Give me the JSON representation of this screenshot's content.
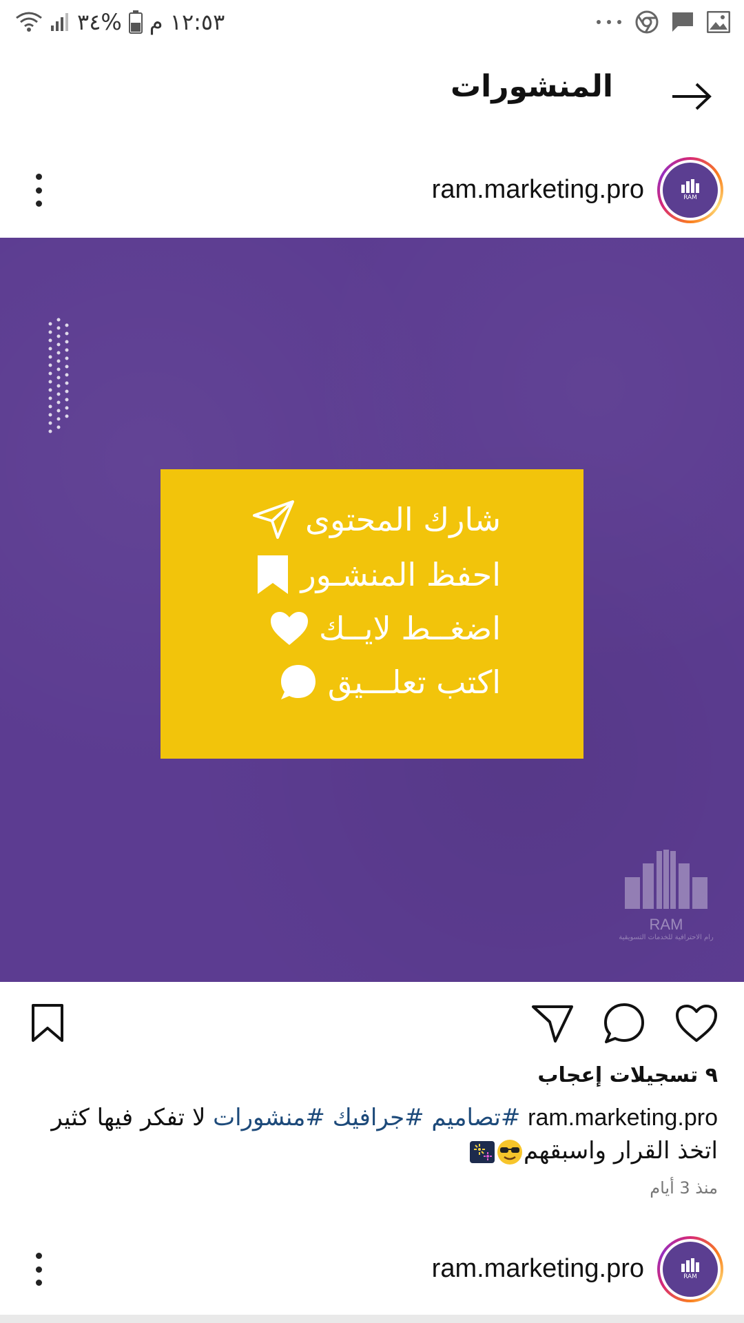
{
  "status_bar": {
    "time": "١٢:٥٣ م",
    "battery": "%٣٤"
  },
  "header": {
    "title": "المنشورات"
  },
  "post": {
    "username": "ram.marketing.pro",
    "avatar_label": "RAM",
    "image": {
      "cta_lines": [
        {
          "text": "شارك المحتوى",
          "icon": "send-icon"
        },
        {
          "text": "احفظ المنشـور",
          "icon": "bookmark-icon"
        },
        {
          "text": "اضغــط لايــك",
          "icon": "heart-icon"
        },
        {
          "text": "اكتب تعلـــيق",
          "icon": "comment-icon"
        }
      ],
      "watermark_name": "RAM",
      "watermark_sub": "رام الاحترافية للخدمات التسويقية"
    },
    "likes": "٩ تسجيلات إعجاب",
    "caption": {
      "user": "ram.marketing.pro",
      "tag1": "#تصاميم",
      "tag2": "#جرافيك",
      "tag3": "#منشورات",
      "text_after": " لا تفكر فيها كثير",
      "line2": "اتخذ القرار واسبقهم"
    },
    "time_ago": "منذ 3 أيام"
  },
  "next_post": {
    "username": "ram.marketing.pro"
  },
  "colors": {
    "image_bg": "#5c3c91",
    "card": "#f2c40b",
    "hashtag": "#1d4a7a"
  }
}
